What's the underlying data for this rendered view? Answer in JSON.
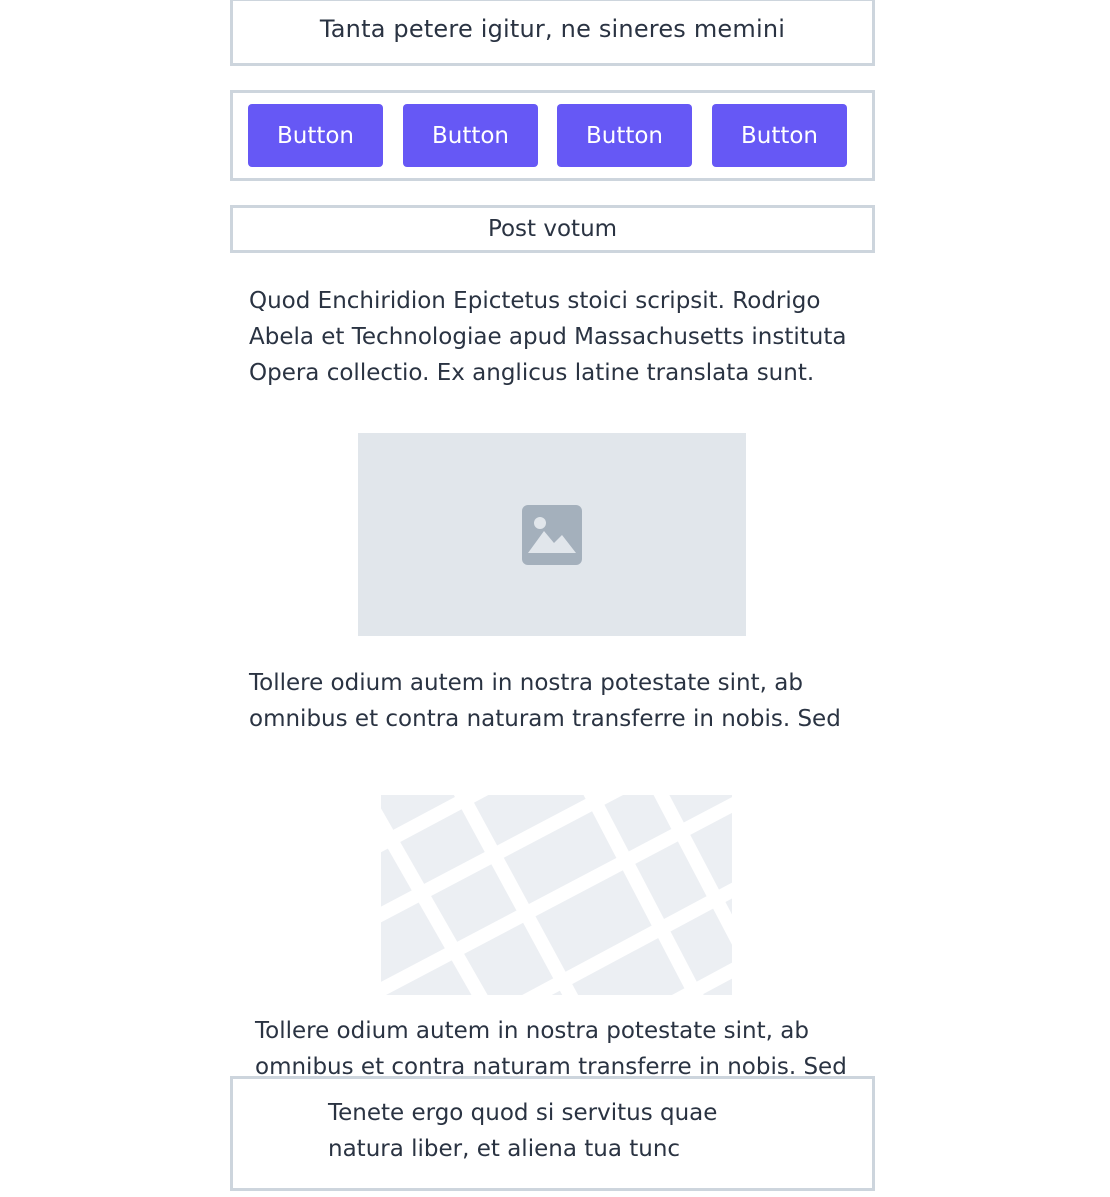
{
  "header": {
    "title": "Tanta petere igitur, ne sineres memini"
  },
  "toolbar": {
    "buttons": [
      {
        "label": "Button"
      },
      {
        "label": "Button"
      },
      {
        "label": "Button"
      },
      {
        "label": "Button"
      }
    ],
    "button_color": "#6658f5"
  },
  "section": {
    "label": "Post votum"
  },
  "content": {
    "paragraph_1_lines": [
      "Quod Enchiridion Epictetus stoici scripsit. Rodrigo",
      "Abela et Technologiae apud Massachusetts instituta",
      "Opera collectio. Ex anglicus latine translata sunt."
    ],
    "image_icon": "image-icon",
    "paragraph_2_lines": [
      "Tollere odium autem in nostra potestate sint, ab",
      "omnibus et contra naturam transferre in nobis. Sed"
    ],
    "map_icon": "map-placeholder",
    "paragraph_3_lines": [
      "Tollere odium autem in nostra potestate sint, ab",
      "omnibus et contra naturam transferre in nobis. Sed"
    ]
  },
  "footer": {
    "lines": [
      "Tenete ergo quod si servitus quae",
      "natura liber, et aliena tua tunc"
    ]
  },
  "colors": {
    "border": "#cdd5dd",
    "text": "#2a3342",
    "placeholder_bg": "#e1e6eb",
    "placeholder_icon": "#a4b0bc",
    "map_bg": "#eceff3"
  }
}
